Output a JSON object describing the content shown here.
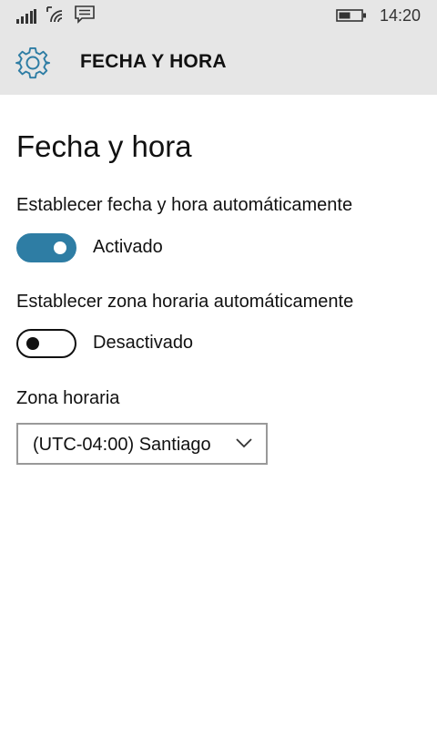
{
  "status_bar": {
    "time": "14:20",
    "icons": [
      "signal-icon",
      "wifi-icon",
      "message-icon",
      "battery-icon"
    ]
  },
  "header": {
    "title": "FECHA Y HORA",
    "icon": "gear-icon"
  },
  "page": {
    "title": "Fecha y hora"
  },
  "settings": {
    "auto_datetime": {
      "label": "Establecer fecha y hora automáticamente",
      "state_text": "Activado",
      "on": true
    },
    "auto_timezone": {
      "label": "Establecer zona horaria automáticamente",
      "state_text": "Desactivado",
      "on": false
    },
    "timezone": {
      "label": "Zona horaria",
      "selected": "(UTC-04:00) Santiago"
    }
  },
  "colors": {
    "accent": "#2e7da4",
    "header_bg": "#e6e6e6",
    "dropdown_border": "#999999"
  }
}
